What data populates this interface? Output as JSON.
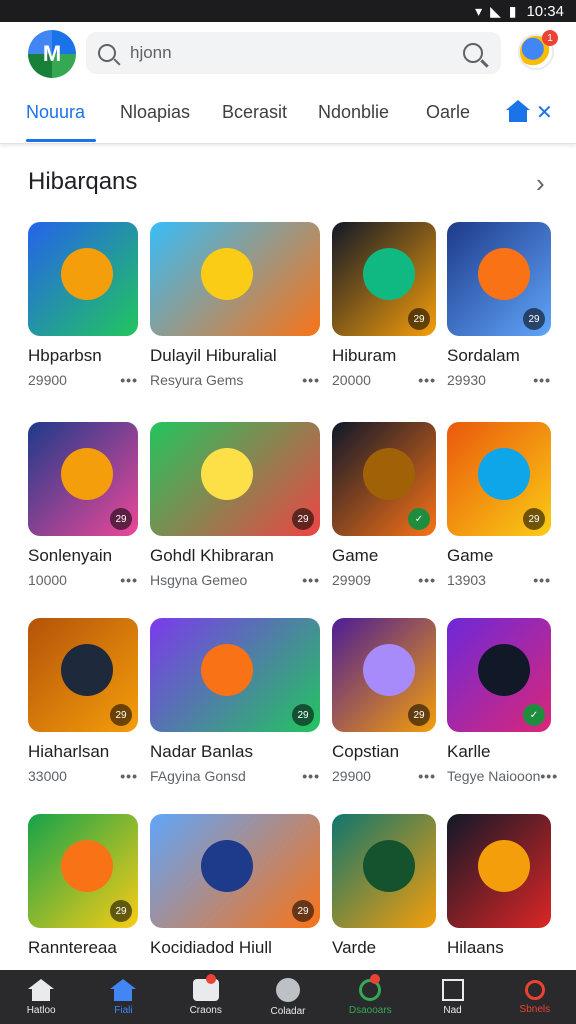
{
  "statusbar": {
    "time": "10:34",
    "icons": "▾ ◣ ▮"
  },
  "header": {
    "logo_text": "M",
    "search_placeholder": "hjonn",
    "avatar_badge": "1"
  },
  "tabs": [
    {
      "label": "Nouura",
      "active": true
    },
    {
      "label": "Nloapias",
      "active": false
    },
    {
      "label": "Bcerasit",
      "active": false
    },
    {
      "label": "Ndonblie",
      "active": false
    },
    {
      "label": "Oarle",
      "active": false
    }
  ],
  "section": {
    "title": "Hibarqans"
  },
  "cards": [
    {
      "title": "Hbparbsn",
      "sub": "29900",
      "colors": [
        "#2563eb",
        "#22c55e",
        "#f59e0b"
      ],
      "tag": ""
    },
    {
      "title": "Dulayil Hiburalial",
      "sub": "Resyura Gems",
      "colors": [
        "#38bdf8",
        "#f97316",
        "#facc15"
      ],
      "tag": ""
    },
    {
      "title": "Hiburam",
      "sub": "20000",
      "colors": [
        "#111827",
        "#f59e0b",
        "#10b981"
      ],
      "tag": "29"
    },
    {
      "title": "Sordalam",
      "sub": "29930",
      "colors": [
        "#1e3a8a",
        "#60a5fa",
        "#f97316"
      ],
      "tag": "29"
    },
    {
      "title": "Sonlenyain",
      "sub": "10000",
      "colors": [
        "#1e3a8a",
        "#ec4899",
        "#f59e0b"
      ],
      "tag": "29"
    },
    {
      "title": "Gohdl Khibraran",
      "sub": "Hsgyna Gemeo",
      "colors": [
        "#22c55e",
        "#ef4444",
        "#fde047"
      ],
      "tag": "29"
    },
    {
      "title": "Game",
      "sub": "29909",
      "colors": [
        "#0f172a",
        "#f97316",
        "#a16207"
      ],
      "tag": "✓"
    },
    {
      "title": "Game",
      "sub": "13903",
      "colors": [
        "#ea580c",
        "#facc15",
        "#0ea5e9"
      ],
      "tag": "29"
    },
    {
      "title": "Hiaharlsan",
      "sub": "33000",
      "colors": [
        "#b45309",
        "#f59e0b",
        "#1e293b"
      ],
      "tag": "29"
    },
    {
      "title": "Nadar Banlas",
      "sub": "FAgyina Gonsd",
      "colors": [
        "#7c3aed",
        "#22c55e",
        "#f97316"
      ],
      "tag": "29"
    },
    {
      "title": "Copstian",
      "sub": "29900",
      "colors": [
        "#4c1d95",
        "#f59e0b",
        "#a78bfa"
      ],
      "tag": "29"
    },
    {
      "title": "Karlle",
      "sub": "Tegye Naiooon",
      "colors": [
        "#6d28d9",
        "#db2777",
        "#111827"
      ],
      "tag": "✓"
    },
    {
      "title": "Ranntereaa",
      "sub": "",
      "colors": [
        "#16a34a",
        "#facc15",
        "#f97316"
      ],
      "tag": "29"
    },
    {
      "title": "Kocidiadod Hiull",
      "sub": "",
      "colors": [
        "#60a5fa",
        "#f97316",
        "#1e3a8a"
      ],
      "tag": "29"
    },
    {
      "title": "Varde",
      "sub": "",
      "colors": [
        "#0f766e",
        "#f59e0b",
        "#14532d"
      ],
      "tag": ""
    },
    {
      "title": "Hilaans",
      "sub": "",
      "colors": [
        "#111827",
        "#dc2626",
        "#f59e0b"
      ],
      "tag": ""
    }
  ],
  "bottomnav": [
    {
      "label": "Hatloo",
      "icon": "home-icon",
      "active": false
    },
    {
      "label": "Fiali",
      "icon": "home-icon",
      "active": true
    },
    {
      "label": "Craons",
      "icon": "wallet-icon",
      "active": false,
      "badge": true
    },
    {
      "label": "Coladar",
      "icon": "circle-icon",
      "active": false
    },
    {
      "label": "Dsaooars",
      "icon": "search-green-icon",
      "active": false,
      "badge": true
    },
    {
      "label": "Nad",
      "icon": "square-icon",
      "active": false
    },
    {
      "label": "Sbnels",
      "icon": "search-red-icon",
      "active": false
    }
  ]
}
